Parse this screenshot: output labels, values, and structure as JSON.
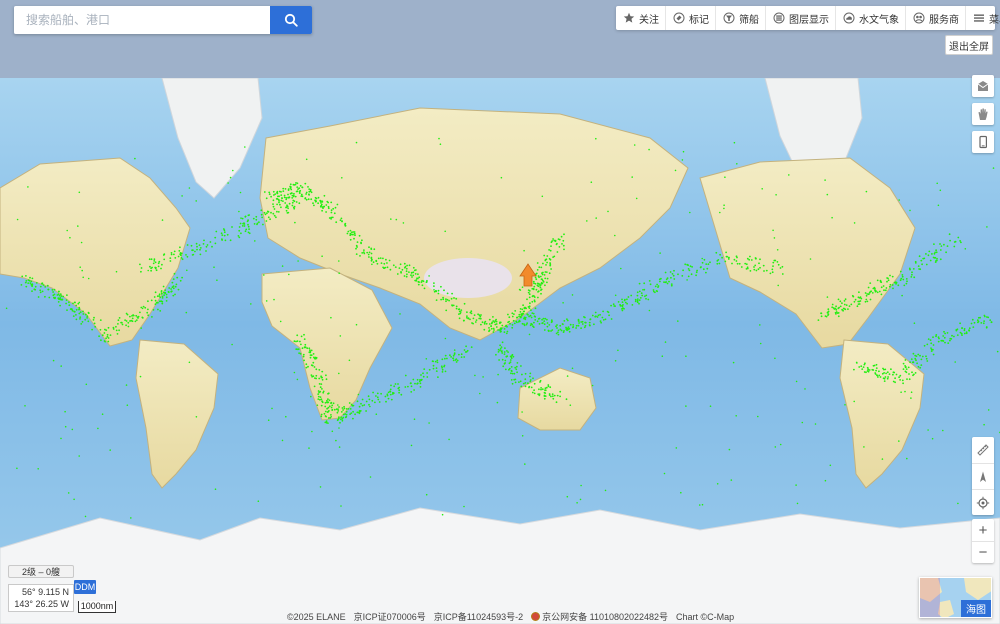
{
  "search": {
    "placeholder": "搜索船舶、港口"
  },
  "toolbar": {
    "items": [
      {
        "label": "关注",
        "icon": "star-icon"
      },
      {
        "label": "标记",
        "icon": "tag-icon"
      },
      {
        "label": "筛船",
        "icon": "filter-icon"
      },
      {
        "label": "图层显示",
        "icon": "layers-icon"
      },
      {
        "label": "水文气象",
        "icon": "cloud-icon"
      },
      {
        "label": "服务商",
        "icon": "service-icon"
      },
      {
        "label": "菜单",
        "icon": "menu-icon"
      }
    ]
  },
  "exit_fullscreen": "退出全屏",
  "right_controls": {
    "top": [
      "mailbox-icon",
      "hand-icon",
      "phone-icon"
    ],
    "tools": [
      "ruler-icon",
      "compass-icon",
      "locate-icon"
    ],
    "zoom_in": "+",
    "zoom_out": "−"
  },
  "status": {
    "level": "2级 – 0艘",
    "lat": "56° 9.115 N",
    "lon": "143° 26.25 W",
    "format": "DDM",
    "scale": "1000nm"
  },
  "footer": {
    "copyright": "©2025 ELANE",
    "icp1": "京ICP证070006号",
    "icp2": "京ICP备11024593号-2",
    "police": "京公网安备 11010802022482号",
    "chart": "Chart ©C-Map"
  },
  "minimap": {
    "label": "海图"
  },
  "colors": {
    "accent": "#2d6fd8",
    "ships": "#22ee11",
    "ocean": "#8dc3eb",
    "land": "#f1e6b6"
  }
}
